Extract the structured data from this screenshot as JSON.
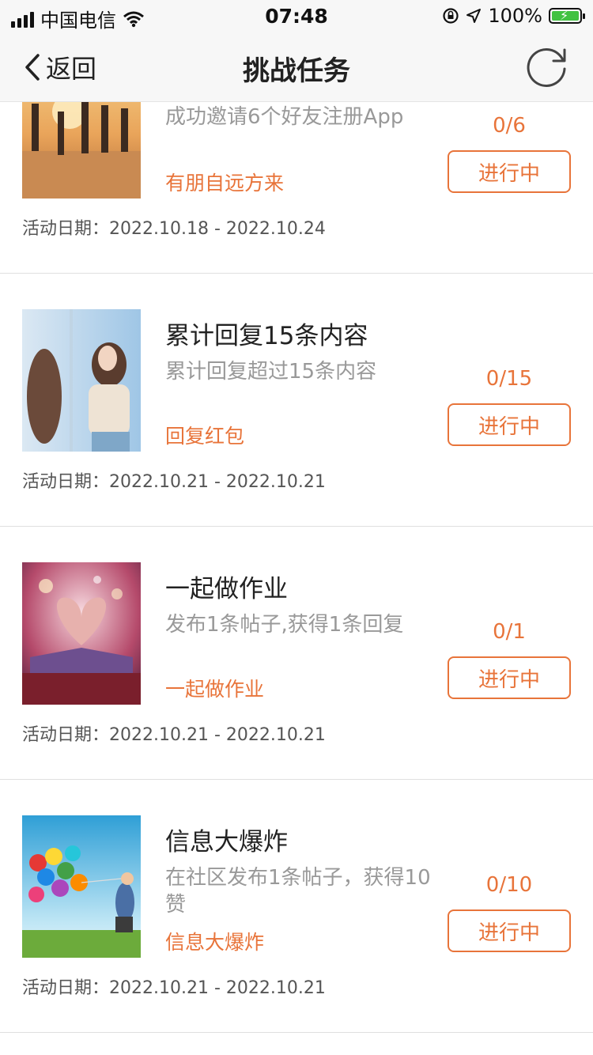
{
  "status": {
    "carrier": "中国电信",
    "time": "07:48",
    "battery": "100%"
  },
  "nav": {
    "back_label": "返回",
    "title": "挑战任务"
  },
  "date_prefix": "活动日期：",
  "tasks": [
    {
      "title": "",
      "desc": "成功邀请6个好友注册App",
      "tag": "有朋自远方来",
      "progress": "0/6",
      "status": "进行中",
      "date": "2022.10.18 - 2022.10.24",
      "image": "beach-friends-photo"
    },
    {
      "title": "累计回复15条内容",
      "desc": "累计回复超过15条内容",
      "tag": "回复红包",
      "progress": "0/15",
      "status": "进行中",
      "date": "2022.10.21 - 2022.10.21",
      "image": "two-girls-window-photo"
    },
    {
      "title": "一起做作业",
      "desc": "发布1条帖子,获得1条回复",
      "tag": "一起做作业",
      "progress": "0/1",
      "status": "进行中",
      "date": "2022.10.21 - 2022.10.21",
      "image": "book-heart-photo"
    },
    {
      "title": "信息大爆炸",
      "desc": "在社区发布1条帖子，获得10赞",
      "tag": "信息大爆炸",
      "progress": "0/10",
      "status": "进行中",
      "date": "2022.10.21 - 2022.10.21",
      "image": "balloons-child-photo"
    }
  ]
}
